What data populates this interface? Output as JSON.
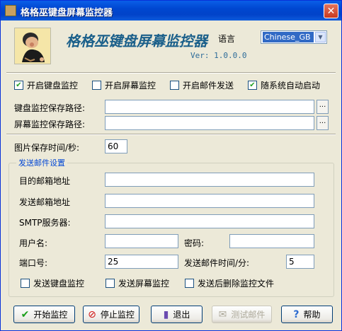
{
  "window": {
    "title": "格格巫键盘屏幕监控器",
    "close_label": "✕"
  },
  "header": {
    "banner": "格格巫键盘屏幕监控器",
    "lang_label": "语言",
    "lang_value": "Chinese_GB",
    "version": "Ver: 1.0.0.0"
  },
  "options": {
    "keyboard_monitor": {
      "label": "开启键盘监控",
      "checked": true
    },
    "screen_monitor": {
      "label": "开启屏幕监控",
      "checked": false
    },
    "mail_send": {
      "label": "开启邮件发送",
      "checked": false
    },
    "autostart": {
      "label": "随系统自动启动",
      "checked": true
    }
  },
  "paths": {
    "keyboard_label": "键盘监控保存路径:",
    "keyboard_value": "",
    "screen_label": "屏幕监控保存路径:",
    "screen_value": "",
    "browse": "..."
  },
  "interval": {
    "label": "图片保存时间/秒:",
    "value": "60"
  },
  "mail": {
    "group_title": "发送邮件设置",
    "to_label": "目的邮箱地址",
    "to_value": "",
    "from_label": "发送邮箱地址",
    "from_value": "",
    "smtp_label": "SMTP服务器:",
    "smtp_value": "",
    "user_label": "用户名:",
    "user_value": "",
    "password_label": "密码:",
    "password_value": "",
    "port_label": "端口号:",
    "port_value": "25",
    "interval_label": "发送邮件时间/分:",
    "interval_value": "5",
    "send_keyboard": {
      "label": "发送键盘监控",
      "checked": false
    },
    "send_screen": {
      "label": "发送屏幕监控",
      "checked": false
    },
    "delete_after": {
      "label": "发送后删除监控文件",
      "checked": false
    }
  },
  "buttons": {
    "start": "开始监控",
    "stop": "停止监控",
    "exit": "退出",
    "test": "测试邮件",
    "help": "帮助"
  },
  "colors": {
    "title_bar": "#0047d0",
    "banner": "#1a5f8a",
    "group_title": "#0046d5",
    "check": "#21a121"
  }
}
